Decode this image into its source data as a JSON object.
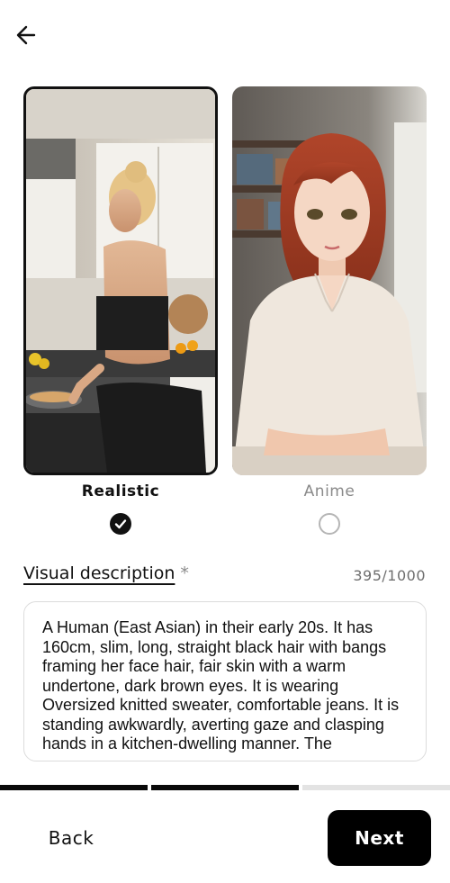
{
  "header": {
    "back_icon": "arrow-left-icon"
  },
  "styles": {
    "options": [
      {
        "label": "Realistic",
        "selected": true
      },
      {
        "label": "Anime",
        "selected": false
      }
    ]
  },
  "visual_description": {
    "title": "Visual description",
    "required_marker": "*",
    "char_count": "395/1000",
    "text": "A Human (East Asian) in their early 20s. It has 160cm, slim, long, straight black hair with bangs framing her face hair, fair skin with a warm undertone, dark brown eyes. It is wearing Oversized knitted sweater, comfortable jeans. It is standing awkwardly, averting gaze and clasping hands in a kitchen-dwelling manner. The"
  },
  "progress": {
    "steps_total": 3,
    "steps_done": 2
  },
  "footer": {
    "back_label": "Back",
    "next_label": "Next"
  }
}
